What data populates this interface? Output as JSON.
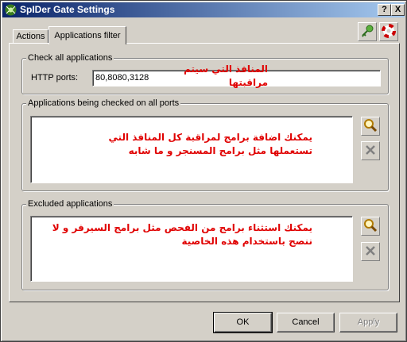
{
  "window": {
    "title": "SpIDer Gate Settings"
  },
  "titlebar_buttons": {
    "help": "?",
    "close": "X"
  },
  "tabs": [
    {
      "label": "Actions"
    },
    {
      "label": "Applications filter"
    }
  ],
  "check_all": {
    "group_label": "Check all applications",
    "http_ports_label": "HTTP ports:",
    "http_ports_value": "80,8080,3128",
    "note": "المنافذ التي سيتم مراقبتها"
  },
  "all_ports": {
    "group_label": "Applications being checked on all ports",
    "note": "يمكنك اضافة برامج لمراقبة كل المنافذ التي تستعملها مثل برامج المسنجر و ما شابه"
  },
  "excluded": {
    "group_label": "Excluded applications",
    "note": "يمكنك استثناء برامج من الفحص مثل برامج السيرفر و لا ننصح باستخدام هذه الخاصية"
  },
  "buttons": {
    "ok": "OK",
    "cancel": "Cancel",
    "apply": "Apply"
  },
  "icons": {
    "app": "spider-icon",
    "tool_1": "key-icon",
    "tool_2": "lifebuoy-icon",
    "add": "magnifier-icon",
    "remove": "x-icon"
  }
}
